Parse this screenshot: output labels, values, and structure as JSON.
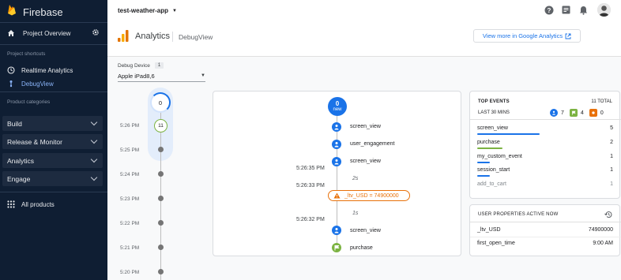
{
  "sidebar": {
    "brand": "Firebase",
    "project_overview": "Project Overview",
    "shortcuts_heading": "Project shortcuts",
    "shortcuts": [
      "Realtime Analytics",
      "DebugView"
    ],
    "categories_heading": "Product categories",
    "categories": [
      "Build",
      "Release & Monitor",
      "Analytics",
      "Engage"
    ],
    "all_products": "All products"
  },
  "topbar": {
    "project_name": "test-weather-app"
  },
  "header": {
    "title": "Analytics",
    "subtitle": "DebugView",
    "ga_link": "View more in Google Analytics"
  },
  "device": {
    "label": "Debug Device",
    "count": "1",
    "selected": "Apple iPad8,6"
  },
  "minute_timeline": {
    "top_count": "0",
    "current_count": "11",
    "times": [
      "5:26 PM",
      "5:25 PM",
      "5:24 PM",
      "5:23 PM",
      "5:22 PM",
      "5:21 PM",
      "5:20 PM"
    ]
  },
  "seconds_stream": {
    "new_count": "0",
    "new_label": "new",
    "events": [
      {
        "label": "screen_view",
        "time": "",
        "kind": "user"
      },
      {
        "label": "user_engagement",
        "time": "",
        "kind": "user"
      },
      {
        "label": "screen_view",
        "time": "5:26:35 PM",
        "kind": "user"
      },
      {
        "gap": "2s"
      },
      {
        "label": "_ltv_USD = 74900000",
        "time": "5:26:33 PM",
        "kind": "property"
      },
      {
        "gap": "1s"
      },
      {
        "label": "screen_view",
        "time": "5:26:32 PM",
        "kind": "user"
      },
      {
        "label": "purchase",
        "time": "",
        "kind": "conversion"
      }
    ]
  },
  "top_events": {
    "title": "TOP EVENTS",
    "total": "11 TOTAL",
    "period": "LAST 30 MINS",
    "counts": {
      "user": "7",
      "conversion": "4",
      "error": "0"
    },
    "rows": [
      {
        "name": "screen_view",
        "count": "5",
        "bar_fraction": 0.5,
        "color": "#1a73e8"
      },
      {
        "name": "purchase",
        "count": "2",
        "bar_fraction": 0.2,
        "color": "#7cb342"
      },
      {
        "name": "my_custom_event",
        "count": "1",
        "bar_fraction": 0.1,
        "color": "#1a73e8"
      },
      {
        "name": "session_start",
        "count": "1",
        "bar_fraction": 0.1,
        "color": "#1a73e8"
      },
      {
        "name": "add_to_cart",
        "count": "1",
        "bar_fraction": 0,
        "color": "#9aa0a6"
      }
    ]
  },
  "user_properties": {
    "title": "USER PROPERTIES ACTIVE NOW",
    "rows": [
      {
        "name": "_ltv_USD",
        "value": "74900000"
      },
      {
        "name": "first_open_time",
        "value": "9:00 AM"
      }
    ]
  },
  "colors": {
    "sidebar_bg": "#0f1e33",
    "accent_blue": "#1a73e8",
    "conversion_green": "#7cb342",
    "property_orange": "#e8710a",
    "error_orange": "#e8710a"
  }
}
